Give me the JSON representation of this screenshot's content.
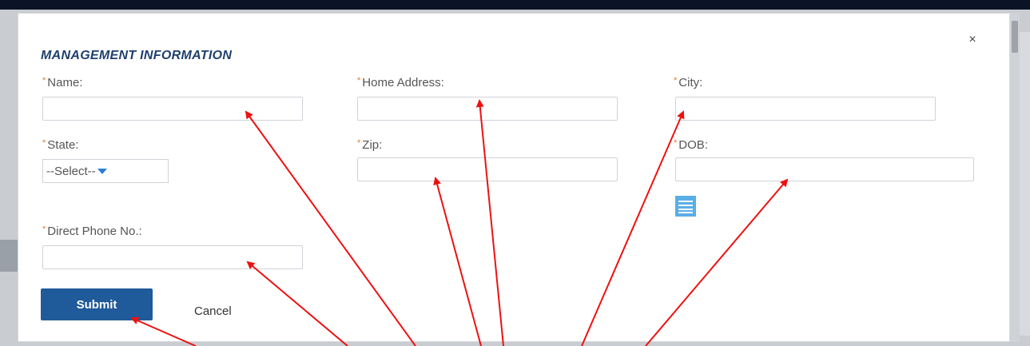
{
  "modal": {
    "title": "MANAGEMENT INFORMATION",
    "close_glyph": "×",
    "required_marker": "*"
  },
  "fields": {
    "name": {
      "label": "Name:",
      "value": "",
      "placeholder": ""
    },
    "home_address": {
      "label": "Home Address:",
      "value": "",
      "placeholder": ""
    },
    "city": {
      "label": "City:",
      "value": "",
      "placeholder": ""
    },
    "state": {
      "label": "State:",
      "selected": "--Select--"
    },
    "zip": {
      "label": "Zip:",
      "value": "",
      "placeholder": ""
    },
    "dob": {
      "label": "DOB:",
      "value": "",
      "placeholder": ""
    },
    "direct_phone": {
      "label": "Direct Phone No.:",
      "value": "",
      "placeholder": ""
    }
  },
  "actions": {
    "submit_label": "Submit",
    "cancel_label": "Cancel"
  },
  "icons": {
    "close": "close-icon",
    "state_dropdown": "chevron-down-icon",
    "dob_picker": "calendar-icon"
  },
  "colors": {
    "title": "#1f3f6e",
    "required": "#e87722",
    "submit_bg": "#1f5a9a",
    "annotation_arrow": "#ee1111",
    "calendar_icon": "#5aaee6"
  }
}
